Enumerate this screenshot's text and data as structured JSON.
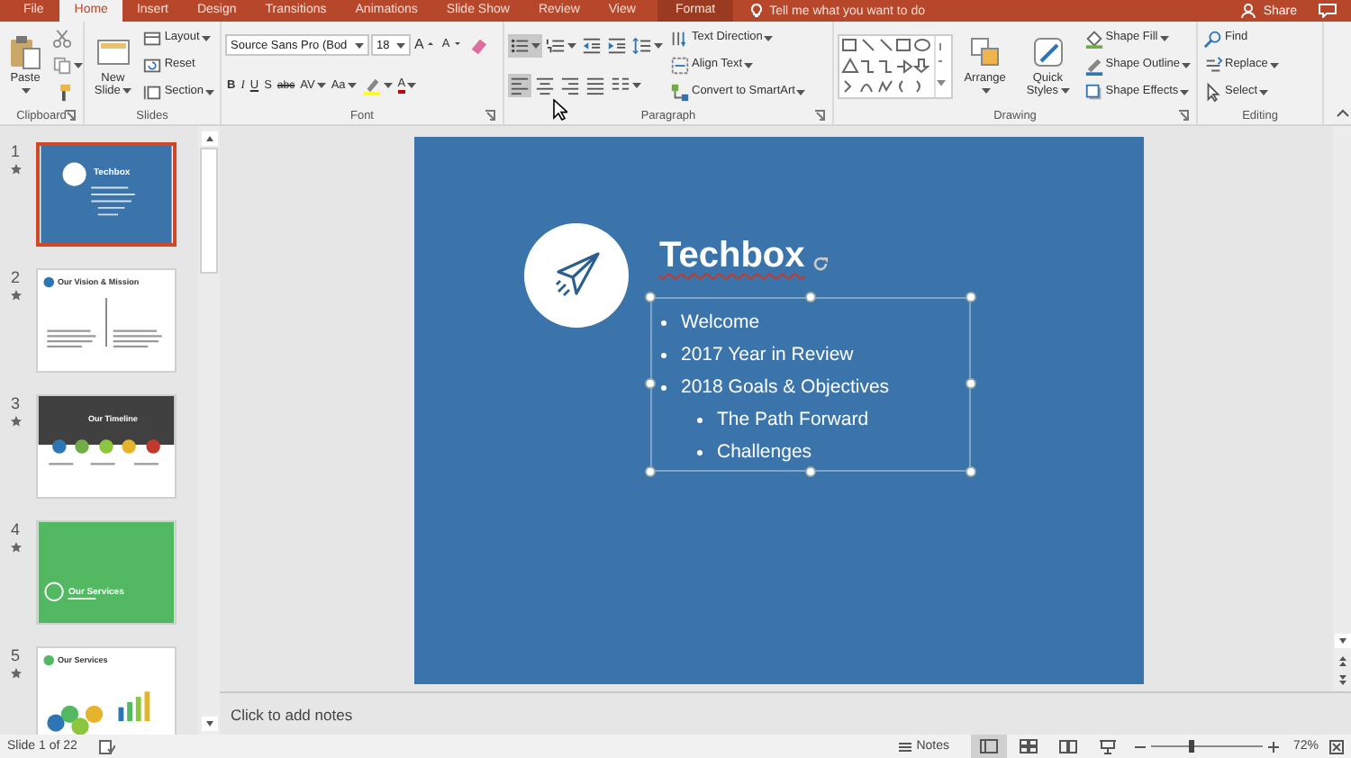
{
  "tabs": [
    {
      "label": "File",
      "selected": false,
      "kind": "file"
    },
    {
      "label": "Home",
      "selected": true,
      "kind": "normal"
    },
    {
      "label": "Insert",
      "selected": false,
      "kind": "normal"
    },
    {
      "label": "Design",
      "selected": false,
      "kind": "normal"
    },
    {
      "label": "Transitions",
      "selected": false,
      "kind": "normal"
    },
    {
      "label": "Animations",
      "selected": false,
      "kind": "normal"
    },
    {
      "label": "Slide Show",
      "selected": false,
      "kind": "normal"
    },
    {
      "label": "Review",
      "selected": false,
      "kind": "normal"
    },
    {
      "label": "View",
      "selected": false,
      "kind": "normal"
    },
    {
      "label": "Format",
      "selected": false,
      "kind": "contextual"
    }
  ],
  "tell_me": {
    "text": "Tell me what you want to do"
  },
  "share": {
    "label": "Share"
  },
  "ribbon": {
    "groups": [
      {
        "label": "Clipboard",
        "launcher": true,
        "columns": [
          [
            [
              {
                "kind": "paste",
                "label": "Paste",
                "dropdown": true
              }
            ]
          ],
          [
            [
              {
                "kind": "cut"
              }
            ],
            [
              {
                "kind": "copy",
                "dropdown": true
              }
            ],
            [
              {
                "kind": "format-painter"
              }
            ]
          ]
        ]
      },
      {
        "label": "Slides",
        "launcher": false,
        "columns": [
          [
            [
              {
                "kind": "new-slide",
                "label": "New Slide",
                "dropdown": true
              }
            ]
          ],
          [
            [
              {
                "kind": "layout",
                "label": "Layout",
                "dropdown": true
              }
            ],
            [
              {
                "kind": "reset",
                "label": "Reset"
              }
            ],
            [
              {
                "kind": "section",
                "label": "Section",
                "dropdown": true
              }
            ]
          ]
        ]
      },
      {
        "label": "Font",
        "launcher": true,
        "columns": [
          [
            [
              {
                "kind": "font-name",
                "value": "Source Sans Pro (Bod"
              },
              {
                "kind": "font-size",
                "value": "18"
              },
              {
                "kind": "grow",
                "label": "A"
              },
              {
                "kind": "shrink",
                "label": "A"
              },
              {
                "kind": "clear-format"
              }
            ],
            [
              {
                "kind": "bold",
                "label": "B",
                "selected": false
              },
              {
                "kind": "italic",
                "label": "I",
                "selected": false
              },
              {
                "kind": "underline",
                "label": "U",
                "selected": false
              },
              {
                "kind": "shadow",
                "label": "S",
                "selected": false
              },
              {
                "kind": "strike",
                "label": "abc",
                "selected": false
              },
              {
                "kind": "spacing",
                "label": "AV",
                "dropdown": true
              },
              {
                "kind": "case",
                "label": "Aa",
                "dropdown": true
              },
              {
                "kind": "highlight",
                "dropdown": true
              },
              {
                "kind": "font-color",
                "label": "A",
                "dropdown": true
              }
            ]
          ]
        ]
      },
      {
        "label": "Paragraph",
        "launcher": true,
        "columns": [
          [
            [
              {
                "kind": "bullets",
                "dropdown": true,
                "selected": true
              },
              {
                "kind": "numbering",
                "dropdown": true,
                "selected": false
              },
              {
                "kind": "outdent"
              },
              {
                "kind": "indent"
              },
              {
                "kind": "line-spacing",
                "dropdown": true
              }
            ],
            [
              {
                "kind": "align-left",
                "selected": true
              },
              {
                "kind": "align-center",
                "selected": false
              },
              {
                "kind": "align-right",
                "selected": false
              },
              {
                "kind": "justify",
                "selected": false
              },
              {
                "kind": "columns",
                "dropdown": true
              }
            ]
          ],
          [
            [
              {
                "kind": "text-direction",
                "label": "Text Direction",
                "dropdown": true
              }
            ],
            [
              {
                "kind": "align-text",
                "label": "Align Text",
                "dropdown": true
              }
            ],
            [
              {
                "kind": "smartart",
                "label": "Convert to SmartArt",
                "dropdown": true
              }
            ]
          ]
        ]
      },
      {
        "label": "Drawing",
        "launcher": true,
        "columns": [
          [
            [
              {
                "kind": "shapes-gallery"
              }
            ]
          ],
          [
            [
              {
                "kind": "arrange",
                "label": "Arrange",
                "dropdown": true
              }
            ]
          ],
          [
            [
              {
                "kind": "quick-styles",
                "label": "Quick Styles",
                "dropdown": true
              }
            ]
          ],
          [
            [
              {
                "kind": "shape-fill",
                "label": "Shape Fill",
                "dropdown": true
              }
            ],
            [
              {
                "kind": "shape-outline",
                "label": "Shape Outline",
                "dropdown": true
              }
            ],
            [
              {
                "kind": "shape-effects",
                "label": "Shape Effects",
                "dropdown": true
              }
            ]
          ]
        ]
      },
      {
        "label": "Editing",
        "launcher": false,
        "columns": [
          [
            [
              {
                "kind": "find",
                "label": "Find"
              }
            ],
            [
              {
                "kind": "replace",
                "label": "Replace",
                "dropdown": true
              }
            ],
            [
              {
                "kind": "select",
                "label": "Select",
                "dropdown": true
              }
            ]
          ]
        ]
      }
    ]
  },
  "slides_pane": {
    "slides": [
      {
        "number": "1",
        "title": "Techbox",
        "kind": "title",
        "selected": true,
        "animated": true
      },
      {
        "number": "2",
        "title": "Our Vision & Mission",
        "kind": "two-column",
        "selected": false,
        "animated": true
      },
      {
        "number": "3",
        "title": "Our Timeline",
        "kind": "timeline",
        "selected": false,
        "animated": true
      },
      {
        "number": "4",
        "title": "Our Services",
        "kind": "section",
        "selected": false,
        "animated": true
      },
      {
        "number": "5",
        "title": "Our Services",
        "kind": "services",
        "selected": false,
        "animated": true
      }
    ]
  },
  "slide": {
    "title": "Techbox",
    "title_misspelled": true,
    "text_box_selected": true,
    "bullets": [
      {
        "text": "Welcome"
      },
      {
        "text": "2017 Year in Review"
      },
      {
        "text": "2018 Goals & Objectives",
        "children": [
          {
            "text": "The Path Forward"
          },
          {
            "text": "Challenges"
          }
        ]
      }
    ]
  },
  "notes": {
    "placeholder": "Click to add notes"
  },
  "status_bar": {
    "slide_info": "Slide 1 of 22",
    "notes": "Notes",
    "views": [
      {
        "kind": "normal",
        "selected": true
      },
      {
        "kind": "sorter",
        "selected": false
      },
      {
        "kind": "reading",
        "selected": false
      },
      {
        "kind": "slideshow",
        "selected": false
      }
    ],
    "zoom": {
      "level": 0.37,
      "reading": "72%"
    }
  }
}
